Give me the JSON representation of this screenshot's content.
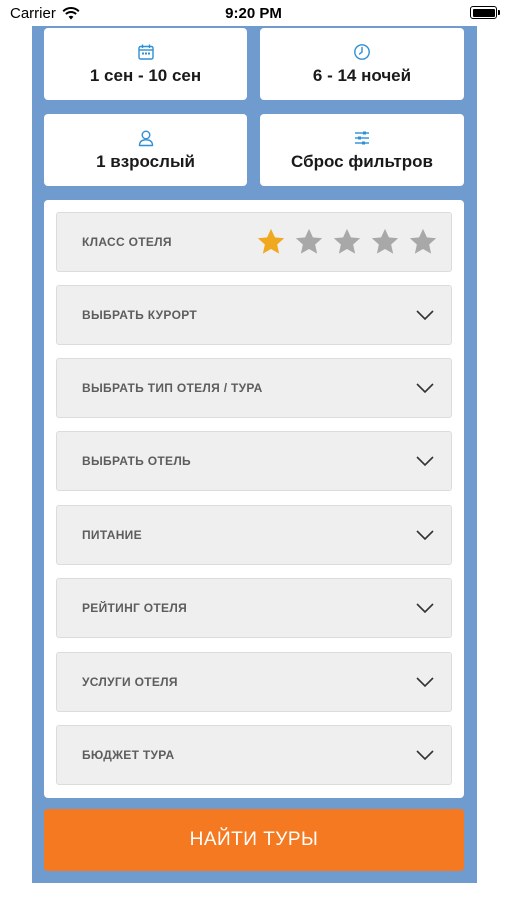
{
  "status_bar": {
    "carrier": "Carrier",
    "time": "9:20 PM"
  },
  "filters": {
    "dates": {
      "label": "1 сен - 10 сен",
      "icon": "calendar-icon"
    },
    "nights": {
      "label": "6 - 14 ночей",
      "icon": "clock-icon"
    },
    "travelers": {
      "label": "1 взрослый",
      "icon": "person-icon"
    },
    "reset": {
      "label": "Сброс фильтров",
      "icon": "sliders-icon"
    }
  },
  "hotel_class": {
    "label": "КЛАСС ОТЕЛЯ",
    "rating": 1,
    "max": 5
  },
  "dropdowns": [
    {
      "label": "ВЫБРАТЬ КУРОРТ"
    },
    {
      "label": "ВЫБРАТЬ ТИП ОТЕЛЯ / ТУРА"
    },
    {
      "label": "ВЫБРАТЬ ОТЕЛЬ"
    },
    {
      "label": "ПИТАНИЕ"
    },
    {
      "label": "РЕЙТИНГ ОТЕЛЯ"
    },
    {
      "label": "УСЛУГИ ОТЕЛЯ"
    },
    {
      "label": "БЮДЖЕТ ТУРА"
    }
  ],
  "search_button": {
    "label": "НАЙТИ ТУРЫ"
  },
  "colors": {
    "frame": "#6f9bce",
    "accent_orange": "#f47920",
    "icon_blue": "#2e8fd6",
    "star_active": "#f0a81e",
    "star_inactive": "#a8a8a8"
  }
}
